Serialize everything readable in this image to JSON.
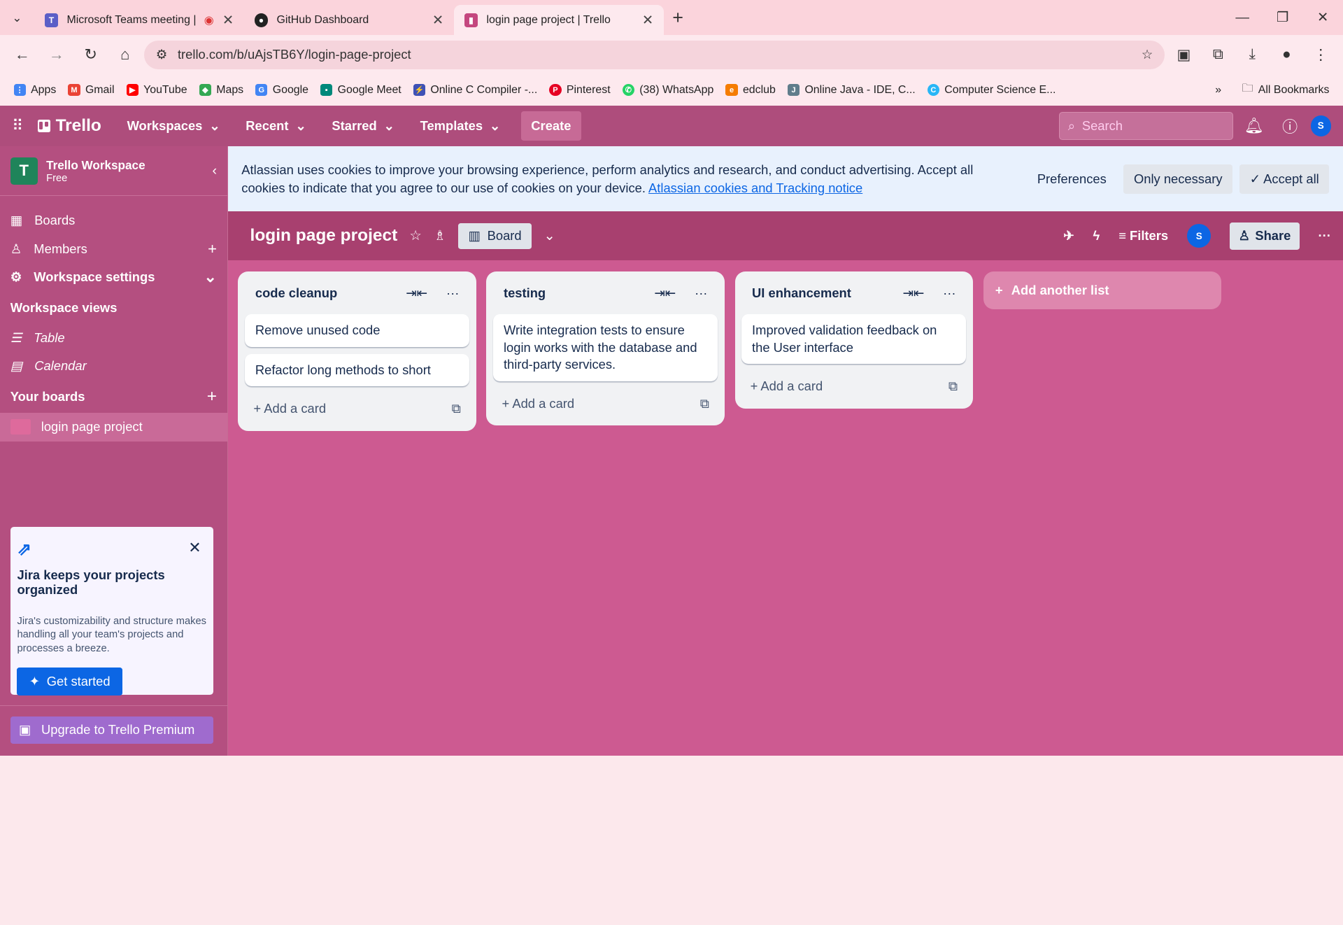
{
  "browser": {
    "tabs": [
      {
        "label": "Microsoft Teams meeting |",
        "icon": "teams-icon"
      },
      {
        "label": "GitHub Dashboard",
        "icon": "github-icon"
      },
      {
        "label": "login page project | Trello",
        "icon": "trello-icon"
      }
    ],
    "url": "trello.com/b/uAjsTB6Y/login-page-project",
    "bookmarks": [
      "Apps",
      "Gmail",
      "YouTube",
      "Maps",
      "Google",
      "Google Meet",
      "Online C Compiler -...",
      "Pinterest",
      "(38) WhatsApp",
      "edclub",
      "Online Java - IDE, C...",
      "Computer Science E..."
    ],
    "all_bookmarks": "All Bookmarks"
  },
  "header": {
    "logo": "Trello",
    "menus": [
      "Workspaces",
      "Recent",
      "Starred",
      "Templates"
    ],
    "create": "Create",
    "search_placeholder": "Search",
    "avatar": "S"
  },
  "sidebar": {
    "workspace_initial": "T",
    "workspace_name": "Trello Workspace",
    "workspace_plan": "Free",
    "items": [
      "Boards",
      "Members",
      "Workspace settings"
    ],
    "views_heading": "Workspace views",
    "views": [
      "Table",
      "Calendar"
    ],
    "your_boards": "Your boards",
    "board": "login page project",
    "jira": {
      "title": "Jira keeps your projects organized",
      "body": "Jira's customizability and structure makes handling all your team's projects and processes a breeze.",
      "button": "Get started"
    },
    "upgrade": "Upgrade to Trello Premium"
  },
  "cookie": {
    "text": "Atlassian uses cookies to improve your browsing experience, perform analytics and research, and conduct advertising. Accept all cookies to indicate that you agree to our use of cookies on your device.",
    "link": "Atlassian cookies and Tracking notice",
    "preferences": "Preferences",
    "only_necessary": "Only necessary",
    "accept_all": "Accept all"
  },
  "board": {
    "title": "login page project",
    "view": "Board",
    "filters": "Filters",
    "share": "Share",
    "member": "S",
    "lists": [
      {
        "title": "code cleanup",
        "cards": [
          "Remove unused code",
          "Refactor long methods to short"
        ]
      },
      {
        "title": "testing",
        "cards": [
          "Write integration tests to ensure login works with the database and third-party services."
        ]
      },
      {
        "title": "UI enhancement",
        "cards": [
          "Improved validation feedback on the User interface"
        ]
      }
    ],
    "add_card": "Add a card",
    "add_list": "Add another list"
  },
  "colors": {
    "header": "#ae4d7c",
    "board_bg": "#cd5a91",
    "sidebar": "#b44f80",
    "primary": "#0c66e4"
  }
}
